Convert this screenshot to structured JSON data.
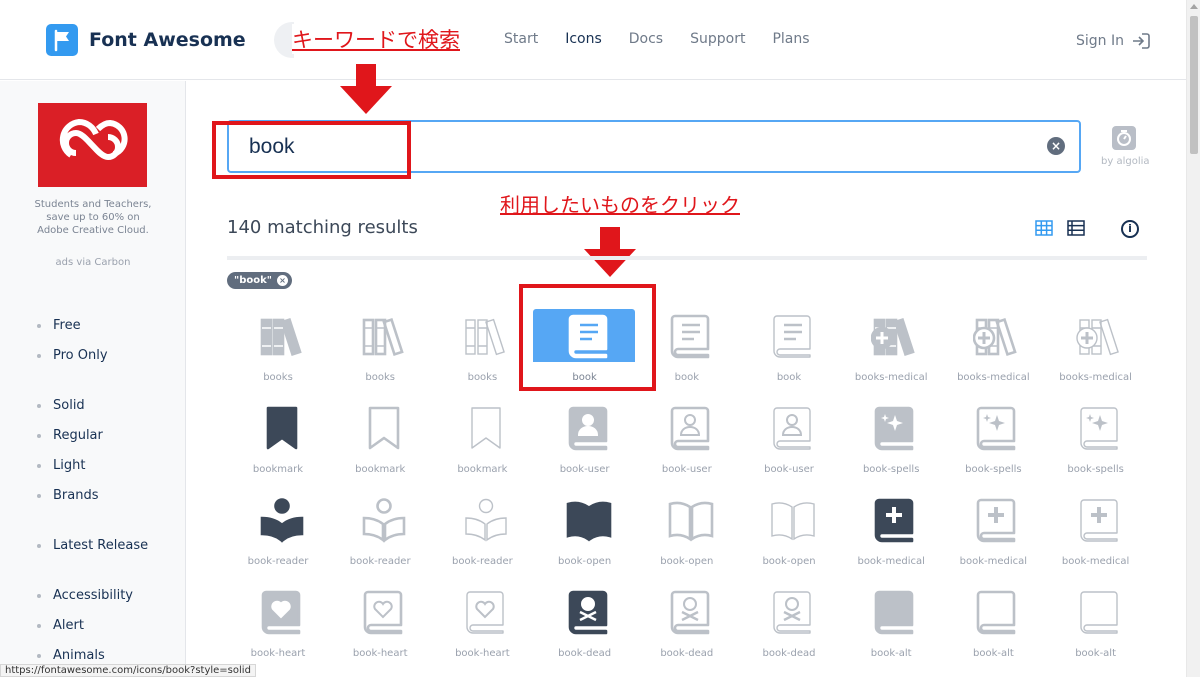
{
  "header": {
    "logo_text": "Font Awesome",
    "annotation_search": "キーワードで検索",
    "nav": [
      {
        "label": "Start",
        "active": false
      },
      {
        "label": "Icons",
        "active": true
      },
      {
        "label": "Docs",
        "active": false
      },
      {
        "label": "Support",
        "active": false
      },
      {
        "label": "Plans",
        "active": false
      }
    ],
    "signin_label": "Sign In"
  },
  "sidebar": {
    "ad_text": "Students and Teachers, save up to 60% on Adobe Creative Cloud.",
    "ad_via": "ads via Carbon",
    "filters": [
      {
        "label": "Free"
      },
      {
        "label": "Pro Only"
      },
      {
        "label": "Solid"
      },
      {
        "label": "Regular"
      },
      {
        "label": "Light"
      },
      {
        "label": "Brands"
      },
      {
        "label": "Latest Release"
      },
      {
        "label": "Accessibility"
      },
      {
        "label": "Alert"
      },
      {
        "label": "Animals"
      }
    ]
  },
  "search": {
    "value": "book",
    "clear_icon": "times-circle-icon",
    "powered_by": "by algolia"
  },
  "results": {
    "annotation_click": "利用したいものをクリック",
    "count_text": "140 matching results",
    "tag_label": "\"book\"",
    "selected_index": 3,
    "icons": [
      {
        "label": "books",
        "icon": "books",
        "style": "solid"
      },
      {
        "label": "books",
        "icon": "books",
        "style": "regular"
      },
      {
        "label": "books",
        "icon": "books",
        "style": "light"
      },
      {
        "label": "book",
        "icon": "book",
        "style": "solid"
      },
      {
        "label": "book",
        "icon": "book",
        "style": "regular"
      },
      {
        "label": "book",
        "icon": "book",
        "style": "light"
      },
      {
        "label": "books-medical",
        "icon": "books-medical",
        "style": "solid"
      },
      {
        "label": "books-medical",
        "icon": "books-medical",
        "style": "regular"
      },
      {
        "label": "books-medical",
        "icon": "books-medical",
        "style": "light"
      },
      {
        "label": "bookmark",
        "icon": "bookmark",
        "style": "solid"
      },
      {
        "label": "bookmark",
        "icon": "bookmark",
        "style": "regular"
      },
      {
        "label": "bookmark",
        "icon": "bookmark",
        "style": "light"
      },
      {
        "label": "book-user",
        "icon": "book-user",
        "style": "solid"
      },
      {
        "label": "book-user",
        "icon": "book-user",
        "style": "regular"
      },
      {
        "label": "book-user",
        "icon": "book-user",
        "style": "light"
      },
      {
        "label": "book-spells",
        "icon": "book-spells",
        "style": "solid"
      },
      {
        "label": "book-spells",
        "icon": "book-spells",
        "style": "regular"
      },
      {
        "label": "book-spells",
        "icon": "book-spells",
        "style": "light"
      },
      {
        "label": "book-reader",
        "icon": "book-reader",
        "style": "solid"
      },
      {
        "label": "book-reader",
        "icon": "book-reader",
        "style": "regular"
      },
      {
        "label": "book-reader",
        "icon": "book-reader",
        "style": "light"
      },
      {
        "label": "book-open",
        "icon": "book-open",
        "style": "solid"
      },
      {
        "label": "book-open",
        "icon": "book-open",
        "style": "regular"
      },
      {
        "label": "book-open",
        "icon": "book-open",
        "style": "light"
      },
      {
        "label": "book-medical",
        "icon": "book-medical",
        "style": "solid"
      },
      {
        "label": "book-medical",
        "icon": "book-medical",
        "style": "regular"
      },
      {
        "label": "book-medical",
        "icon": "book-medical",
        "style": "light"
      },
      {
        "label": "book-heart",
        "icon": "book-heart",
        "style": "solid"
      },
      {
        "label": "book-heart",
        "icon": "book-heart",
        "style": "regular"
      },
      {
        "label": "book-heart",
        "icon": "book-heart",
        "style": "light"
      },
      {
        "label": "book-dead",
        "icon": "book-dead",
        "style": "solid"
      },
      {
        "label": "book-dead",
        "icon": "book-dead",
        "style": "regular"
      },
      {
        "label": "book-dead",
        "icon": "book-dead",
        "style": "light"
      },
      {
        "label": "book-alt",
        "icon": "book-alt",
        "style": "solid"
      },
      {
        "label": "book-alt",
        "icon": "book-alt",
        "style": "regular"
      },
      {
        "label": "book-alt",
        "icon": "book-alt",
        "style": "light"
      }
    ]
  },
  "status_bar": {
    "url": "https://fontawesome.com/icons/book?style=solid"
  },
  "colors": {
    "accent": "#339af0",
    "selected_bg": "#56a7f4",
    "annotation_red": "#e0161b",
    "pro_icon_gray": "#bcc1c8",
    "free_icon_dark": "#3c4858"
  }
}
